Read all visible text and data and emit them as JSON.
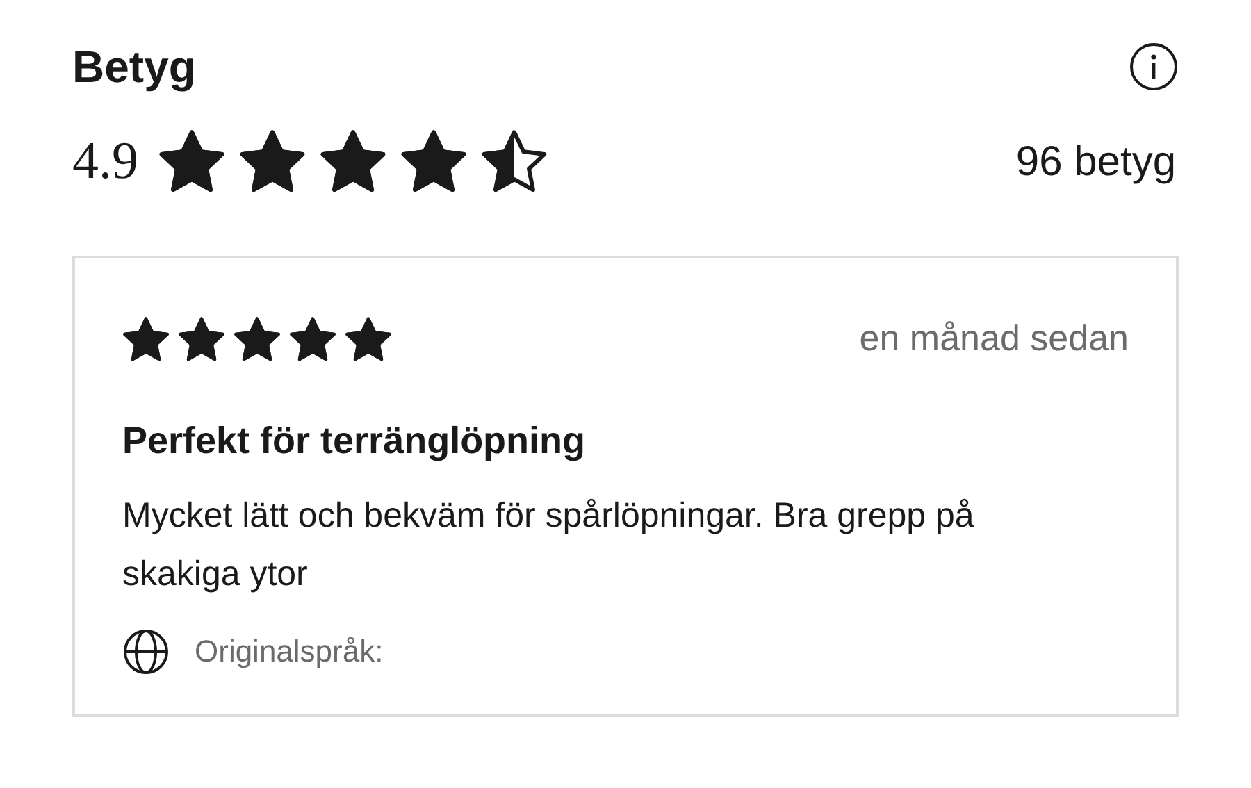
{
  "title": "Betyg",
  "summary": {
    "score": "4.9",
    "stars": 4.5,
    "count": "96 betyg"
  },
  "reviews": [
    {
      "stars": 5,
      "date": "en månad sedan",
      "headline": "Perfekt för terränglöpning",
      "body": "Mycket lätt och bekväm för spårlöpningar. Bra grepp på skakiga ytor",
      "language_label": "Originalspråk:"
    }
  ]
}
